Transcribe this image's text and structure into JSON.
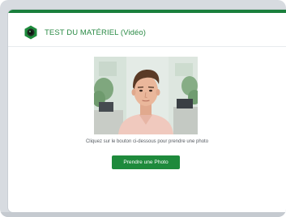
{
  "header": {
    "title": "TEST DU MATÉRIEL (Vidéo)",
    "logo_icon": "webcam-icon"
  },
  "main": {
    "preview_image": "user-webcam-preview",
    "instruction": "Cliquez sur le bouton ci-dessous pour prendre une photo",
    "take_photo_label": "Prendre une Photo"
  },
  "colors": {
    "accent": "#1e8a3c",
    "title": "#2a8a45",
    "frame": "#d7dbe0"
  }
}
